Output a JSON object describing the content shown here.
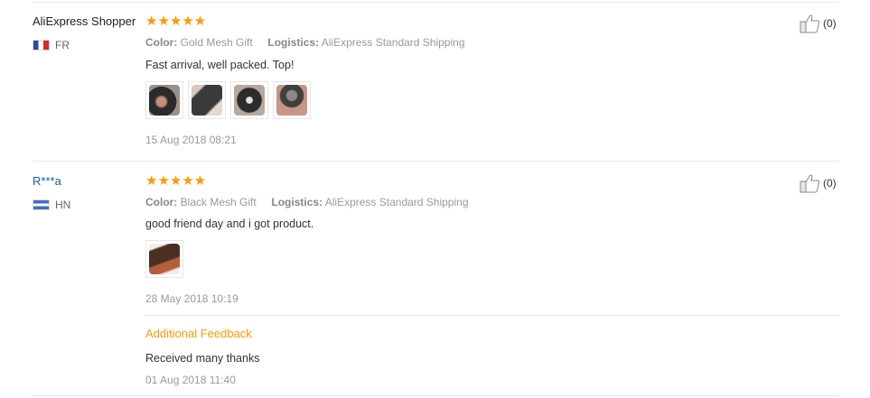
{
  "reviews": [
    {
      "user_name": "AliExpress Shopper",
      "country": "FR",
      "stars": "★★★★★",
      "color_label": "Color:",
      "color_value": "Gold Mesh Gift",
      "logistics_label": "Logistics:",
      "logistics_value": "AliExpress Standard Shipping",
      "content": "Fast arrival, well packed. Top!",
      "photo_count": 4,
      "date": "15 Aug 2018 08:21",
      "helpful_count": "(0)"
    },
    {
      "user_name": "R***a",
      "country": "HN",
      "stars": "★★★★★",
      "color_label": "Color:",
      "color_value": "Black Mesh Gift",
      "logistics_label": "Logistics:",
      "logistics_value": "AliExpress Standard Shipping",
      "content": "good friend day and i got product.",
      "photo_count": 1,
      "date": "28 May 2018 10:19",
      "helpful_count": "(0)",
      "additional_feedback": {
        "title": "Additional Feedback",
        "content": "Received many thanks",
        "date": "01 Aug 2018 11:40"
      }
    }
  ],
  "colors": {
    "star": "#ff9900",
    "link": "#1a5da5",
    "additional": "#ff9900"
  },
  "icons": [
    "thumbs-up-icon",
    "flag-fr-icon",
    "flag-hn-icon"
  ]
}
